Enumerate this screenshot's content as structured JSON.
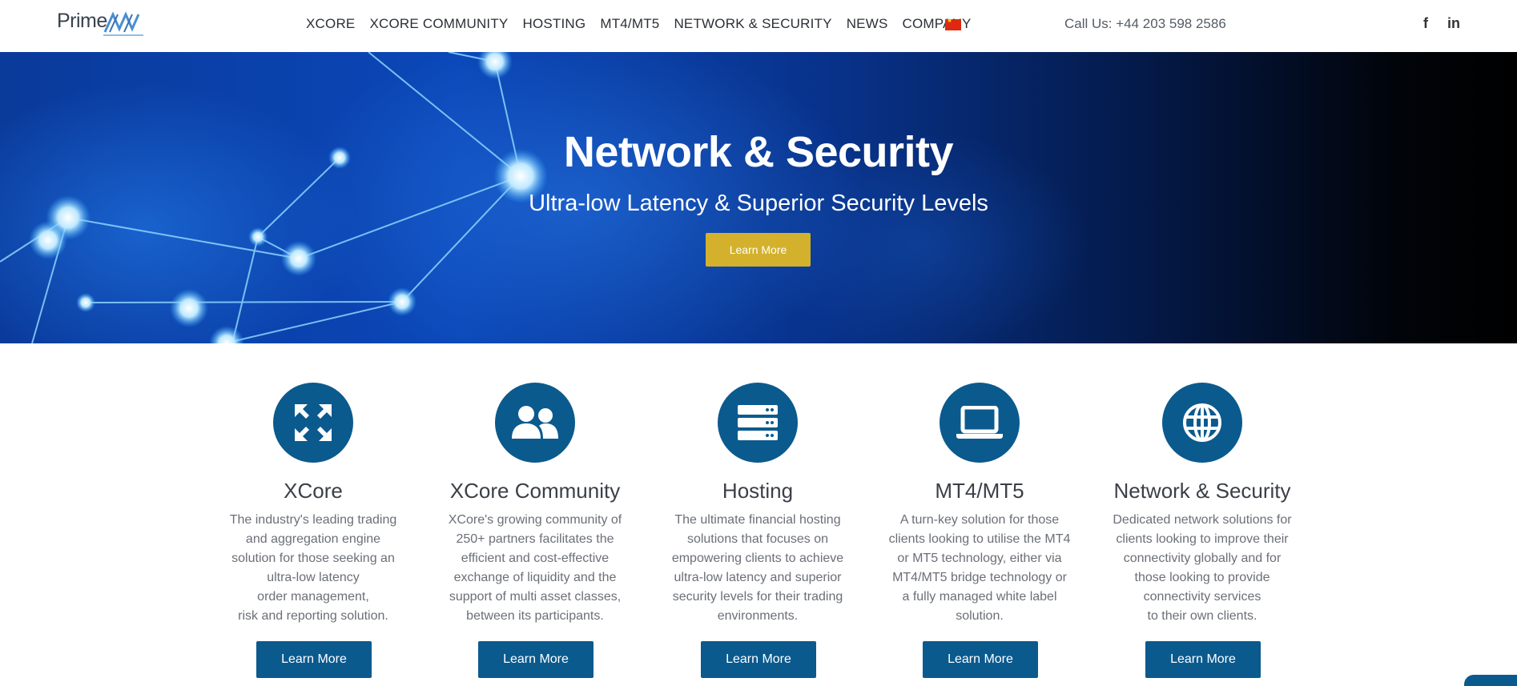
{
  "header": {
    "logo_text": "Prime",
    "nav": [
      "XCORE",
      "XCORE COMMUNITY",
      "HOSTING",
      "MT4/MT5",
      "NETWORK & SECURITY",
      "NEWS",
      "COMPANY"
    ],
    "flag_icon": "china-flag-icon",
    "phone": "Call Us: +44 203 598 2586",
    "social": {
      "facebook": "f",
      "linkedin": "in"
    }
  },
  "hero": {
    "title": "Network & Security",
    "subtitle": "Ultra-low Latency & Superior Security Levels",
    "button": "Learn More"
  },
  "cards": [
    {
      "icon": "expand-arrows-icon",
      "title": "XCore",
      "desc": "The industry's leading trading\nand aggregation engine\nsolution for those seeking an\nultra-low latency\norder management,\nrisk and reporting solution.",
      "button": "Learn More"
    },
    {
      "icon": "users-icon",
      "title": "XCore Community",
      "desc": "XCore's growing community of\n250+ partners facilitates the\nefficient and cost-effective\nexchange of liquidity and the\nsupport of multi asset classes,\nbetween its participants.",
      "button": "Learn More"
    },
    {
      "icon": "server-icon",
      "title": "Hosting",
      "desc": "The ultimate financial hosting\nsolutions that focuses on\nempowering clients to achieve\nultra-low latency and superior\nsecurity levels for their trading\nenvironments.",
      "button": "Learn More"
    },
    {
      "icon": "laptop-icon",
      "title": "MT4/MT5",
      "desc": "A turn-key solution for those\nclients looking to utilise the MT4\nor MT5 technology, either via\nMT4/MT5 bridge technology or\na fully managed white label\nsolution.",
      "button": "Learn More"
    },
    {
      "icon": "globe-icon",
      "title": "Network & Security",
      "desc": "Dedicated network solutions for\nclients looking to improve their\nconnectivity globally and for\nthose looking to provide\nconnectivity services\nto their own clients.",
      "button": "Learn More"
    }
  ],
  "colors": {
    "brand_blue": "#0b5a8e",
    "hero_button": "#d3b12c"
  }
}
